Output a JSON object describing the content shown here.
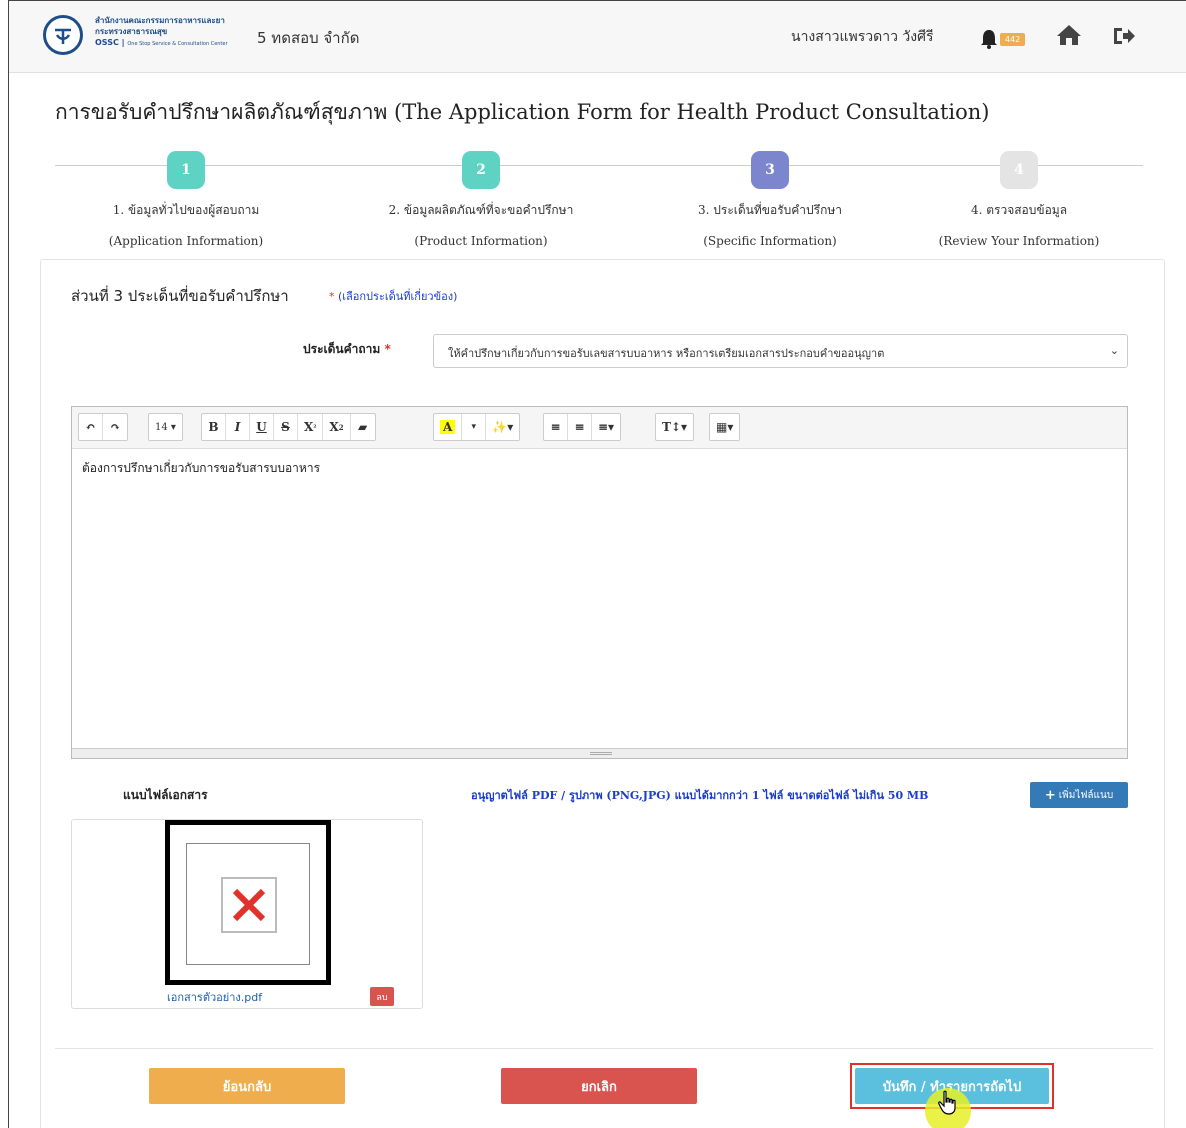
{
  "header": {
    "agency_name": "สำนักงานคณะกรรมการอาหารและยา",
    "ministry": "กระทรวงสาธารณสุข",
    "ossc_label": "OSSC",
    "ossc_full": "One Stop Service & Consultation Center",
    "company": "5 ทดสอบ จำกัด",
    "user_name": "นางสาวแพรวดาว วังศีรี",
    "notification_count": "442"
  },
  "page": {
    "title": "การขอรับคำปรึกษาผลิตภัณฑ์สุขภาพ (The Application Form for Health Product Consultation)"
  },
  "steps": [
    {
      "number": "1",
      "label": "1. ข้อมูลทั่วไปของผู้สอบถาม",
      "sub": "(Application Information)",
      "color": "#5fd3c3"
    },
    {
      "number": "2",
      "label": "2. ข้อมูลผลิตภัณฑ์ที่จะขอคำปรึกษา",
      "sub": "(Product Information)",
      "color": "#5fd3c3"
    },
    {
      "number": "3",
      "label": "3. ประเด็นที่ขอรับคำปรึกษา",
      "sub": "(Specific Information)",
      "color": "#7b86cf"
    },
    {
      "number": "4",
      "label": "4. ตรวจสอบข้อมูล",
      "sub": "(Review Your Information)",
      "color": "#e4e4e4"
    }
  ],
  "section": {
    "title": "ส่วนที่ 3 ประเด็นที่ขอรับคำปรึกษา",
    "note_star": "*",
    "note": "(เลือกประเด็นที่เกี่ยวข้อง)"
  },
  "question": {
    "label": "ประเด็นคำถาม",
    "required_mark": "*",
    "selected": "ให้คำปรึกษาเกี่ยวกับการขอรับเลขสารบบอาหาร หรือการเตรียมเอกสารประกอบคำขออนุญาต"
  },
  "editor": {
    "font_size": "14",
    "content": "ต้องการปรึกษาเกี่ยวกับการขอรับสารบบอาหาร"
  },
  "attachments": {
    "label": "แนบไฟล์เอกสาร",
    "note": "อนุญาตไฟล์ PDF / รูปภาพ (PNG,JPG) แนบได้มากกว่า 1 ไฟล์ ขนาดต่อไฟล์ ไม่เกิน 50 MB",
    "add_button": "เพิ่มไฟล์แนบ",
    "files": [
      {
        "name": "เอกสารตัวอย่าง.pdf",
        "delete_label": "ลบ"
      }
    ]
  },
  "buttons": {
    "back": "ย้อนกลับ",
    "cancel": "ยกเลิก",
    "next": "บันทึก / ทำรายการถัดไป"
  },
  "colors": {
    "primary": "#337ab7",
    "warning": "#f0ad4e",
    "danger": "#d9534f",
    "info": "#5bc0de",
    "link_blue": "#1a3ccf"
  }
}
